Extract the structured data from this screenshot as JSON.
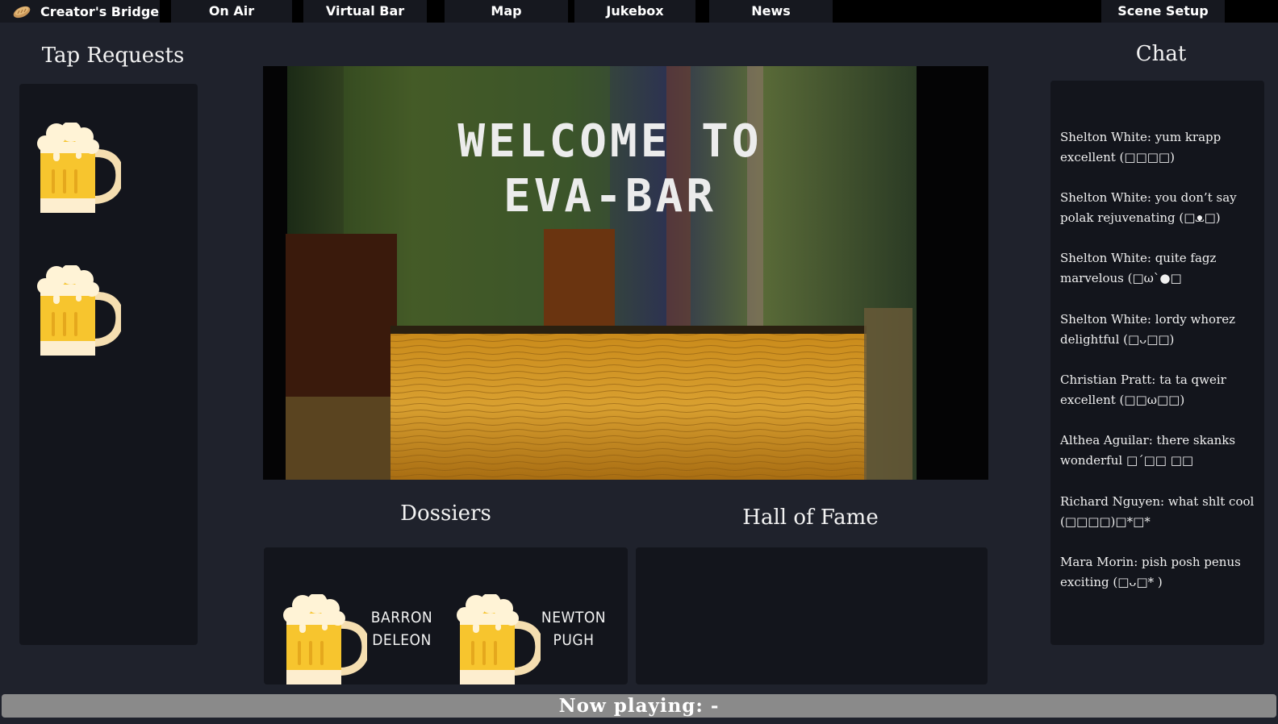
{
  "nav": {
    "brand": "Creator's Bridge",
    "tabs": [
      "On Air",
      "Virtual Bar",
      "Map",
      "Jukebox",
      "News"
    ],
    "scene_setup": "Scene Setup"
  },
  "tap_requests": {
    "title": "Tap Requests",
    "items": [
      "beer-mug-icon",
      "beer-mug-icon"
    ]
  },
  "video": {
    "line1": "WELCOME TO",
    "line2": "EVA-BAR"
  },
  "dossiers": {
    "title": "Dossiers",
    "people": [
      {
        "first": "BARRON",
        "last": "DELEON"
      },
      {
        "first": "NEWTON",
        "last": "PUGH"
      }
    ]
  },
  "hall_of_fame": {
    "title": "Hall of Fame"
  },
  "chat": {
    "title": "Chat",
    "messages": [
      "Shelton White: yum krapp excellent (□□□□)",
      "Shelton White: you don’t say polak rejuvenating (□ᴥ□)",
      "Shelton White: quite fagz marvelous (□ω`●□",
      "Shelton White: lordy whorez delightful (□ᴗ□□)",
      "Christian Pratt: ta ta qweir excellent (□□ω□□)",
      "Althea Aguilar: there skanks wonderful □´□□ □□",
      "Richard Nguyen: what shlt cool (□□□□)□*□*",
      "Mara Morin: pish posh penus exciting (□ᴗ□* )"
    ]
  },
  "now_playing": {
    "label": "Now playing: -"
  },
  "colors": {
    "background": "#1f222c",
    "panel": "#13151c",
    "nav_tab": "#16181f",
    "now_playing_bar": "#8a8a8a",
    "beer": "#f7c52e",
    "foam": "#fff3d6"
  }
}
